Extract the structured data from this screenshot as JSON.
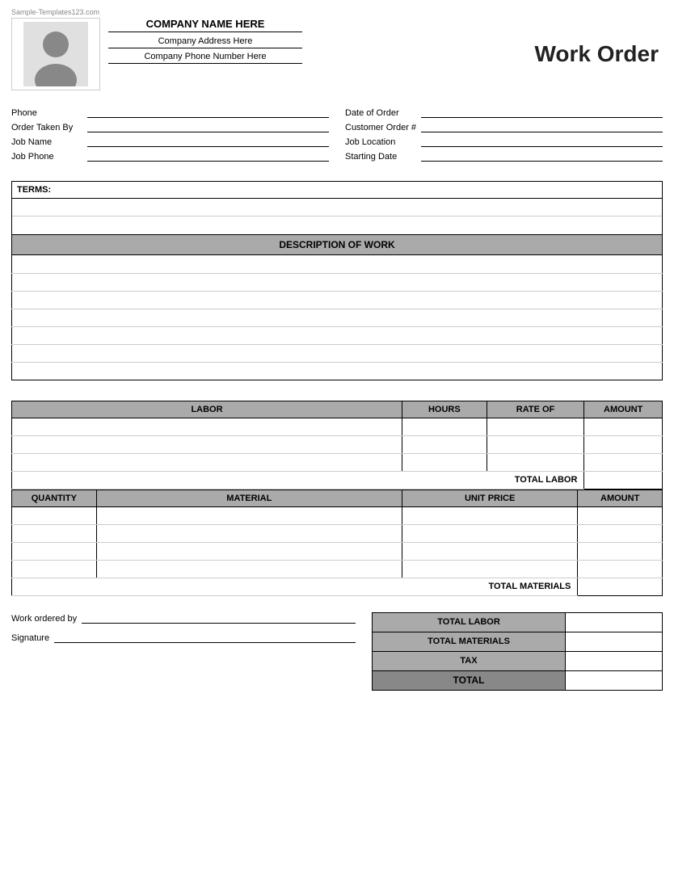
{
  "watermark": "Sample-Templates123.com",
  "header": {
    "company_name": "COMPANY NAME HERE",
    "company_address": "Company Address Here",
    "company_phone": "Company Phone Number Here",
    "title": "Work Order"
  },
  "form": {
    "left": [
      {
        "label": "Phone",
        "id": "phone"
      },
      {
        "label": "Order Taken By",
        "id": "order-taken-by"
      },
      {
        "label": "Job Name",
        "id": "job-name"
      },
      {
        "label": "Job Phone",
        "id": "job-phone"
      }
    ],
    "right": [
      {
        "label": "Date of Order",
        "id": "date-of-order"
      },
      {
        "label": "Customer Order #",
        "id": "customer-order"
      },
      {
        "label": "Job Location",
        "id": "job-location"
      },
      {
        "label": "Starting Date",
        "id": "starting-date"
      }
    ]
  },
  "terms": {
    "label": "TERMS:",
    "rows": 3
  },
  "description": {
    "header": "DESCRIPTION OF WORK",
    "rows": 7
  },
  "labor": {
    "columns": [
      "LABOR",
      "HOURS",
      "RATE OF",
      "AMOUNT"
    ],
    "rows": 3,
    "total_label": "TOTAL LABOR"
  },
  "materials": {
    "columns": [
      "QUANTITY",
      "MATERIAL",
      "UNIT PRICE",
      "AMOUNT"
    ],
    "rows": 4,
    "total_label": "TOTAL MATERIALS"
  },
  "summary": {
    "rows": [
      {
        "label": "TOTAL LABOR"
      },
      {
        "label": "TOTAL MATERIALS"
      },
      {
        "label": "TAX"
      },
      {
        "label": "TOTAL"
      }
    ]
  },
  "signature": {
    "work_ordered_by": "Work ordered by",
    "signature": "Signature"
  }
}
